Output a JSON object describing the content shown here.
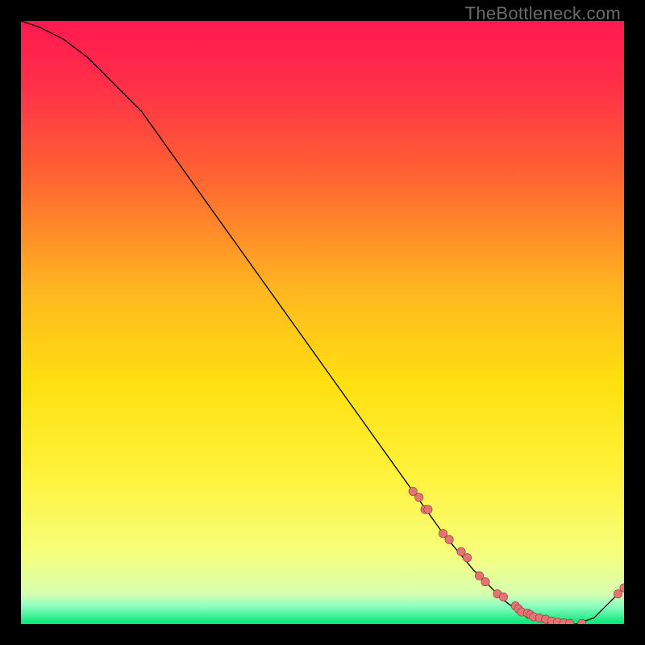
{
  "watermark": "TheBottleneck.com",
  "chart_data": {
    "type": "line",
    "title": "",
    "xlabel": "",
    "ylabel": "",
    "xlim": [
      0,
      100
    ],
    "ylim": [
      0,
      100
    ],
    "grid": false,
    "legend": false,
    "background_gradient": {
      "top": "#ff1744",
      "upper_mid": "#ff6d2f",
      "mid": "#ffd400",
      "lower_mid": "#f9ff66",
      "bottom_band": "#00e676",
      "bottom_band_frac": 0.03
    },
    "series": [
      {
        "name": "bottleneck-curve",
        "type": "line",
        "color": "#000000",
        "width": 1.3,
        "x": [
          0,
          3,
          7,
          11,
          15,
          20,
          25,
          30,
          35,
          40,
          45,
          50,
          55,
          60,
          65,
          70,
          75,
          80,
          84,
          88,
          92,
          95,
          100
        ],
        "y": [
          100,
          99,
          97,
          94,
          90,
          85,
          78,
          71,
          64,
          57,
          50,
          43,
          36,
          29,
          22,
          15,
          9,
          4,
          1,
          0,
          0,
          1,
          6
        ]
      },
      {
        "name": "data-points",
        "type": "scatter",
        "marker_color": "#e57373",
        "marker_outline": "#8d3a3a",
        "marker_radius": 5.2,
        "x": [
          65,
          66,
          67,
          67.5,
          70,
          71,
          73,
          74,
          76,
          77,
          79,
          80,
          82,
          82.5,
          83,
          84,
          84.5,
          85,
          86,
          87,
          88,
          89,
          90,
          91,
          93,
          99,
          100
        ],
        "y": [
          22,
          21,
          19,
          19,
          15,
          14,
          12,
          11,
          8,
          7,
          5,
          4.5,
          3,
          2.5,
          2,
          1.8,
          1.5,
          1.2,
          1,
          0.8,
          0.5,
          0.3,
          0.2,
          0.1,
          0.1,
          5,
          6
        ]
      }
    ]
  }
}
